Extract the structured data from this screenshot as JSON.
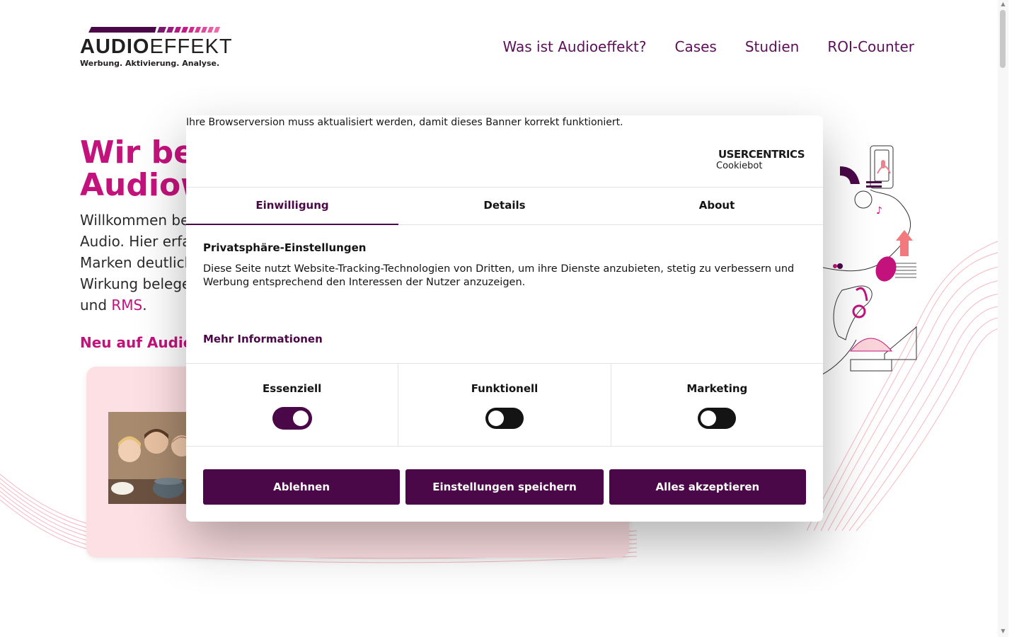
{
  "logo": {
    "word_bold": "AUDIO",
    "word_thin": "EFFEKT",
    "tagline": "Werbung. Aktivierung. Analyse."
  },
  "nav": {
    "items": [
      {
        "label": "Was ist Audioeffekt?"
      },
      {
        "label": "Cases"
      },
      {
        "label": "Studien"
      },
      {
        "label": "ROI-Counter"
      }
    ]
  },
  "hero": {
    "title_line1": "Wir bel",
    "title_line2": "Audiow",
    "text_lines": [
      "Willkommen be",
      "Audio. Hier erfa",
      "Marken deutlich",
      "Wirkung belege"
    ],
    "text_last_prefix": "und ",
    "text_last_link": "RMS",
    "text_last_suffix": ".",
    "subheading": "Neu auf Audioe"
  },
  "dialog": {
    "browser_note": "Ihre Browserversion muss aktualisiert werden, damit dieses Banner korrekt funktioniert.",
    "brand_top": "USERCENTRICS",
    "brand_sub": "Cookiebot",
    "tabs": [
      {
        "label": "Einwilligung",
        "active": true
      },
      {
        "label": "Details",
        "active": false
      },
      {
        "label": "About",
        "active": false
      }
    ],
    "heading": "Privatsphäre-Einstellungen",
    "body": "Diese Seite nutzt Website-Tracking-Technologien von Dritten, um ihre Dienste anzubieten, stetig zu verbessern und Werbung entsprechend den Interessen der Nutzer anzuzeigen.",
    "more_info": "Mehr Informationen",
    "toggles": [
      {
        "label": "Essenziell",
        "on": true
      },
      {
        "label": "Funktionell",
        "on": false
      },
      {
        "label": "Marketing",
        "on": false
      }
    ],
    "buttons": {
      "decline": "Ablehnen",
      "save": "Einstellungen speichern",
      "accept_all": "Alles akzeptieren"
    }
  },
  "colors": {
    "brand_purple": "#4b0848",
    "magenta": "#c4127d",
    "card_pink": "#fde0e3"
  }
}
